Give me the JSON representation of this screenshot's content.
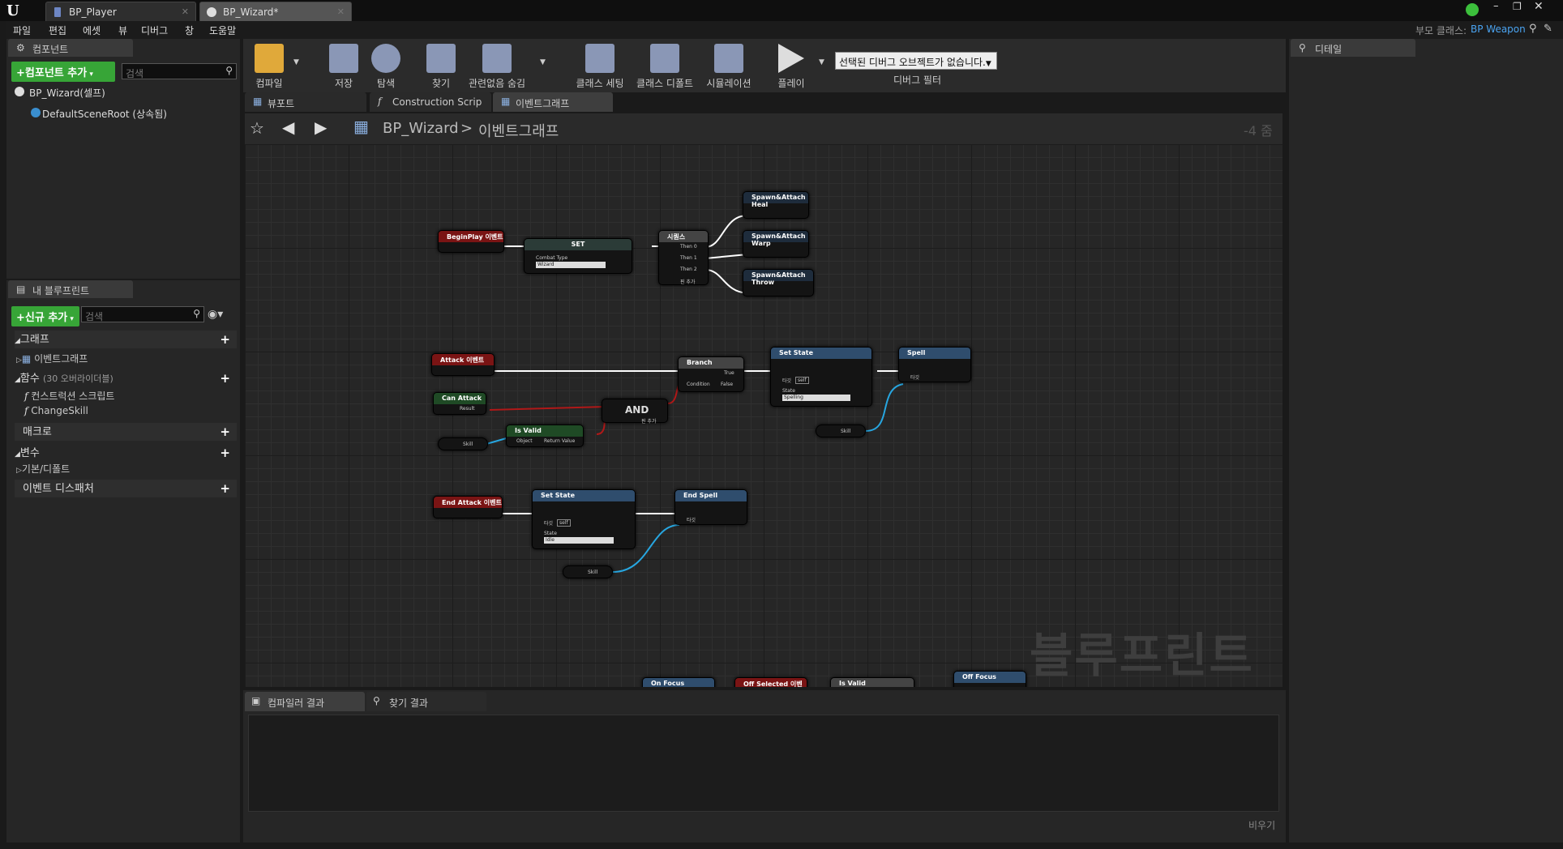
{
  "titlebar": {
    "tabs": [
      "BP_Player",
      "BP_Wizard*"
    ]
  },
  "menubar": {
    "items": [
      "파일",
      "편집",
      "에셋",
      "뷰",
      "디버그",
      "창",
      "도움말"
    ],
    "parent_class_label": "부모 클래스:",
    "parent_class_value": "BP Weapon"
  },
  "components_panel": {
    "tab": "컴포넌트",
    "add_button": "+컴포넌트 추가",
    "search_placeholder": "검색",
    "tree": [
      "BP_Wizard(셀프)",
      "DefaultSceneRoot (상속됨)"
    ]
  },
  "my_blueprint": {
    "tab": "내 블루프린트",
    "add_button": "+신규 추가",
    "search_placeholder": "검색",
    "sections": {
      "graph": "그래프",
      "graph_item": "이벤트그래프",
      "functions": "함수",
      "functions_overrides": "(30 오버라이더블)",
      "function_items": [
        "컨스트럭션 스크립트",
        "ChangeSkill"
      ],
      "macros": "매크로",
      "variables": "변수",
      "variables_default": "기본/디폴트",
      "event_dispatchers": "이벤트 디스패처"
    }
  },
  "toolbar": {
    "compile": "컴파일",
    "save": "저장",
    "browse": "탐색",
    "find": "찾기",
    "hide_unrelated": "관련없음 숨김",
    "class_settings": "클래스 세팅",
    "class_defaults": "클래스 디폴트",
    "simulation": "시뮬레이션",
    "play": "플레이",
    "debug_object": "선택된 디버그 오브젝트가 없습니다.",
    "debug_filter": "디버그 필터"
  },
  "graph_tabs": [
    "뷰포트",
    "Construction Scrip",
    "이벤트그래프"
  ],
  "breadcrumb": {
    "blueprint": "BP_Wizard",
    "separator": ">",
    "graph": "이벤트그래프",
    "zoom": "-4 줌"
  },
  "watermark": "블루프린트",
  "nodes": {
    "beginplay": "BeginPlay 이벤트",
    "set": "SET",
    "combat_type": "Combat Type",
    "combat_value": "Wizard",
    "sequence": "시퀀스",
    "then0": "Then 0",
    "then1": "Then 1",
    "then2": "Then 2",
    "add_pin": "핀 추가",
    "spawn_heal": "Spawn&Attach Heal",
    "spawn_warp": "Spawn&Attach Warp",
    "spawn_throw": "Spawn&Attach Throw",
    "attack": "Attack 이벤트",
    "can_attack": "Can Attack",
    "result": "Result",
    "and": "AND",
    "skill": "Skill",
    "is_valid": "Is Valid",
    "object": "Object",
    "return_value": "Return Value",
    "branch": "Branch",
    "condition": "Condition",
    "true": "True",
    "false": "False",
    "set_state": "Set State",
    "target": "타깃",
    "self": "self",
    "state": "State",
    "spelling": "Spelling",
    "spell": "Spell",
    "end_attack": "End Attack 이벤트",
    "idle": "Idle",
    "end_spell": "End Spell",
    "on_focus": "On Focus",
    "off_selected": "Off Selected 이벤트",
    "off_focus": "Off Focus"
  },
  "bottom_tabs": [
    "컴파일러 결과",
    "찾기 결과"
  ],
  "clear_button": "비우기",
  "details": {
    "tab": "디테일"
  }
}
